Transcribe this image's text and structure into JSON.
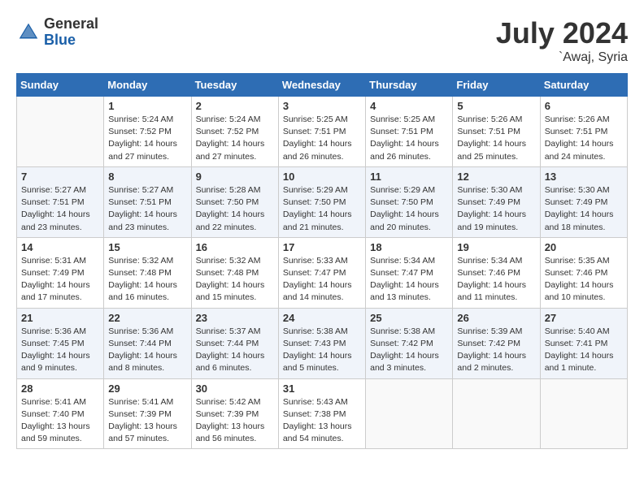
{
  "logo": {
    "general": "General",
    "blue": "Blue"
  },
  "title": {
    "month_year": "July 2024",
    "location": "`Awaj, Syria"
  },
  "days_of_week": [
    "Sunday",
    "Monday",
    "Tuesday",
    "Wednesday",
    "Thursday",
    "Friday",
    "Saturday"
  ],
  "weeks": [
    [
      {
        "day": "",
        "info": ""
      },
      {
        "day": "1",
        "info": "Sunrise: 5:24 AM\nSunset: 7:52 PM\nDaylight: 14 hours\nand 27 minutes."
      },
      {
        "day": "2",
        "info": "Sunrise: 5:24 AM\nSunset: 7:52 PM\nDaylight: 14 hours\nand 27 minutes."
      },
      {
        "day": "3",
        "info": "Sunrise: 5:25 AM\nSunset: 7:51 PM\nDaylight: 14 hours\nand 26 minutes."
      },
      {
        "day": "4",
        "info": "Sunrise: 5:25 AM\nSunset: 7:51 PM\nDaylight: 14 hours\nand 26 minutes."
      },
      {
        "day": "5",
        "info": "Sunrise: 5:26 AM\nSunset: 7:51 PM\nDaylight: 14 hours\nand 25 minutes."
      },
      {
        "day": "6",
        "info": "Sunrise: 5:26 AM\nSunset: 7:51 PM\nDaylight: 14 hours\nand 24 minutes."
      }
    ],
    [
      {
        "day": "7",
        "info": "Sunrise: 5:27 AM\nSunset: 7:51 PM\nDaylight: 14 hours\nand 23 minutes."
      },
      {
        "day": "8",
        "info": "Sunrise: 5:27 AM\nSunset: 7:51 PM\nDaylight: 14 hours\nand 23 minutes."
      },
      {
        "day": "9",
        "info": "Sunrise: 5:28 AM\nSunset: 7:50 PM\nDaylight: 14 hours\nand 22 minutes."
      },
      {
        "day": "10",
        "info": "Sunrise: 5:29 AM\nSunset: 7:50 PM\nDaylight: 14 hours\nand 21 minutes."
      },
      {
        "day": "11",
        "info": "Sunrise: 5:29 AM\nSunset: 7:50 PM\nDaylight: 14 hours\nand 20 minutes."
      },
      {
        "day": "12",
        "info": "Sunrise: 5:30 AM\nSunset: 7:49 PM\nDaylight: 14 hours\nand 19 minutes."
      },
      {
        "day": "13",
        "info": "Sunrise: 5:30 AM\nSunset: 7:49 PM\nDaylight: 14 hours\nand 18 minutes."
      }
    ],
    [
      {
        "day": "14",
        "info": "Sunrise: 5:31 AM\nSunset: 7:49 PM\nDaylight: 14 hours\nand 17 minutes."
      },
      {
        "day": "15",
        "info": "Sunrise: 5:32 AM\nSunset: 7:48 PM\nDaylight: 14 hours\nand 16 minutes."
      },
      {
        "day": "16",
        "info": "Sunrise: 5:32 AM\nSunset: 7:48 PM\nDaylight: 14 hours\nand 15 minutes."
      },
      {
        "day": "17",
        "info": "Sunrise: 5:33 AM\nSunset: 7:47 PM\nDaylight: 14 hours\nand 14 minutes."
      },
      {
        "day": "18",
        "info": "Sunrise: 5:34 AM\nSunset: 7:47 PM\nDaylight: 14 hours\nand 13 minutes."
      },
      {
        "day": "19",
        "info": "Sunrise: 5:34 AM\nSunset: 7:46 PM\nDaylight: 14 hours\nand 11 minutes."
      },
      {
        "day": "20",
        "info": "Sunrise: 5:35 AM\nSunset: 7:46 PM\nDaylight: 14 hours\nand 10 minutes."
      }
    ],
    [
      {
        "day": "21",
        "info": "Sunrise: 5:36 AM\nSunset: 7:45 PM\nDaylight: 14 hours\nand 9 minutes."
      },
      {
        "day": "22",
        "info": "Sunrise: 5:36 AM\nSunset: 7:44 PM\nDaylight: 14 hours\nand 8 minutes."
      },
      {
        "day": "23",
        "info": "Sunrise: 5:37 AM\nSunset: 7:44 PM\nDaylight: 14 hours\nand 6 minutes."
      },
      {
        "day": "24",
        "info": "Sunrise: 5:38 AM\nSunset: 7:43 PM\nDaylight: 14 hours\nand 5 minutes."
      },
      {
        "day": "25",
        "info": "Sunrise: 5:38 AM\nSunset: 7:42 PM\nDaylight: 14 hours\nand 3 minutes."
      },
      {
        "day": "26",
        "info": "Sunrise: 5:39 AM\nSunset: 7:42 PM\nDaylight: 14 hours\nand 2 minutes."
      },
      {
        "day": "27",
        "info": "Sunrise: 5:40 AM\nSunset: 7:41 PM\nDaylight: 14 hours\nand 1 minute."
      }
    ],
    [
      {
        "day": "28",
        "info": "Sunrise: 5:41 AM\nSunset: 7:40 PM\nDaylight: 13 hours\nand 59 minutes."
      },
      {
        "day": "29",
        "info": "Sunrise: 5:41 AM\nSunset: 7:39 PM\nDaylight: 13 hours\nand 57 minutes."
      },
      {
        "day": "30",
        "info": "Sunrise: 5:42 AM\nSunset: 7:39 PM\nDaylight: 13 hours\nand 56 minutes."
      },
      {
        "day": "31",
        "info": "Sunrise: 5:43 AM\nSunset: 7:38 PM\nDaylight: 13 hours\nand 54 minutes."
      },
      {
        "day": "",
        "info": ""
      },
      {
        "day": "",
        "info": ""
      },
      {
        "day": "",
        "info": ""
      }
    ]
  ]
}
